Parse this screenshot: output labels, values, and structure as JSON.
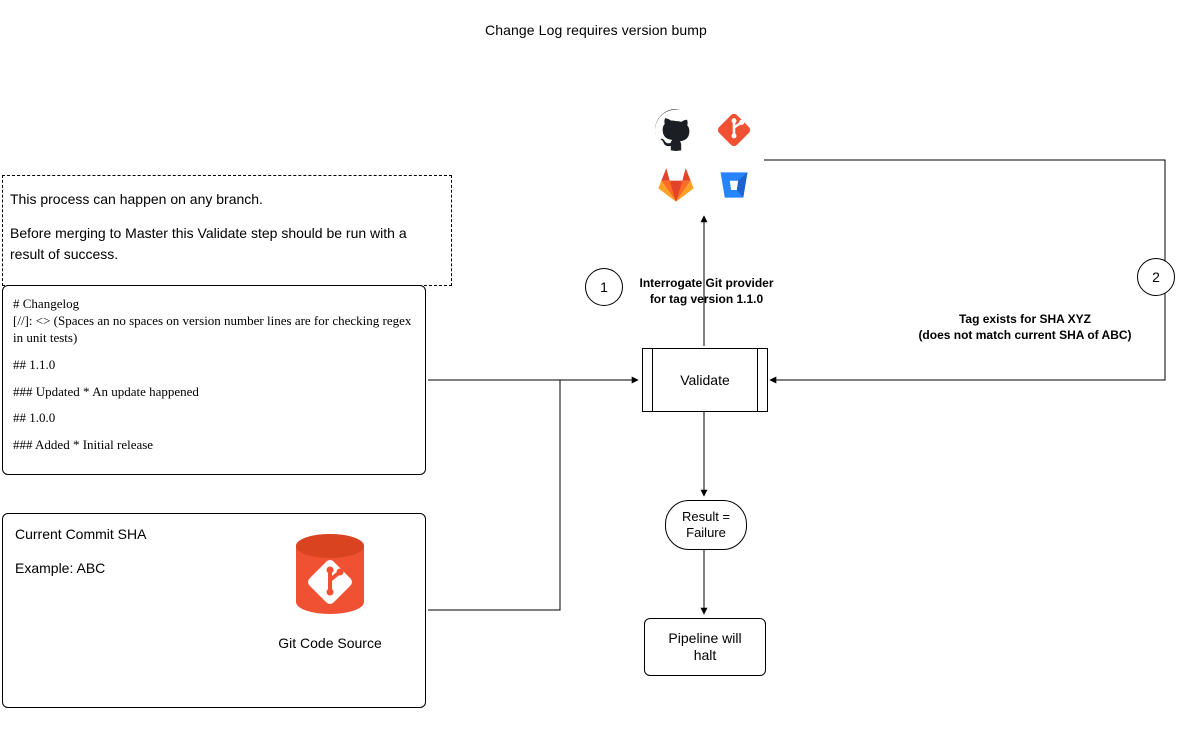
{
  "title": "Change Log requires version bump",
  "steps": {
    "one": "1",
    "two": "2"
  },
  "note": {
    "line1": "This process can happen on any branch.",
    "line2": "Before merging to Master this Validate step should be run with a result of success."
  },
  "changelog": {
    "h1": "# Changelog",
    "meta": "[//]: <> (Spaces an no spaces on version number lines are for checking regex in unit tests)",
    "v110": "## 1.1.0",
    "v110_updated": "### Updated * An update happened",
    "v100": "## 1.0.0",
    "v100_added": "### Added * Initial release"
  },
  "commit": {
    "heading": "Current Commit SHA",
    "example": "Example: ABC",
    "source_label": "Git Code Source"
  },
  "providers": {
    "github": "github-icon",
    "git": "git-icon",
    "gitlab": "gitlab-icon",
    "bitbucket": "bitbucket-icon"
  },
  "process": {
    "validate": "Validate",
    "result_line1": "Result =",
    "result_line2": "Failure",
    "halt_line1": "Pipeline will",
    "halt_line2": "halt"
  },
  "labels": {
    "interrogate_line1": "Interrogate Git provider",
    "interrogate_line2": "for tag version 1.1.0",
    "tag_line1": "Tag exists for SHA XYZ",
    "tag_line2": "(does not match current SHA of ABC)"
  },
  "colors": {
    "git_red": "#f05133",
    "gitlab_orange": "#fc6d26",
    "gitlab_deep": "#e24329",
    "gitlab_yellow": "#fca326",
    "bitbucket_blue": "#2684ff",
    "github_black": "#1b1f23"
  },
  "chart_data": {
    "type": "diagram",
    "nodes": [
      {
        "id": "note",
        "kind": "note",
        "text": "This process can happen on any branch. Before merging to Master this Validate step should be run with a result of success."
      },
      {
        "id": "changelog",
        "kind": "document",
        "text": "# Changelog / [//]: <> (Spaces an no spaces on version number lines are for checking regex in unit tests) / ## 1.1.0 / ### Updated * An update happened / ## 1.0.0 / ### Added * Initial release"
      },
      {
        "id": "commit",
        "kind": "datastore",
        "text": "Current Commit SHA — Example: ABC — Git Code Source"
      },
      {
        "id": "providers",
        "kind": "external",
        "text": "GitHub, Git, GitLab, Bitbucket"
      },
      {
        "id": "validate",
        "kind": "process",
        "text": "Validate"
      },
      {
        "id": "result",
        "kind": "terminator",
        "text": "Result = Failure"
      },
      {
        "id": "halt",
        "kind": "process",
        "text": "Pipeline will halt"
      }
    ],
    "edges": [
      {
        "from": "changelog",
        "to": "validate",
        "directed": true
      },
      {
        "from": "commit",
        "to": "validate",
        "directed": true
      },
      {
        "from": "validate",
        "to": "providers",
        "directed": true,
        "step": 1,
        "label": "Interrogate Git provider for tag version 1.1.0"
      },
      {
        "from": "providers",
        "to": "validate",
        "directed": true,
        "step": 2,
        "label": "Tag exists for SHA XYZ (does not match current SHA of ABC)"
      },
      {
        "from": "validate",
        "to": "result",
        "directed": true
      },
      {
        "from": "result",
        "to": "halt",
        "directed": true
      }
    ]
  }
}
